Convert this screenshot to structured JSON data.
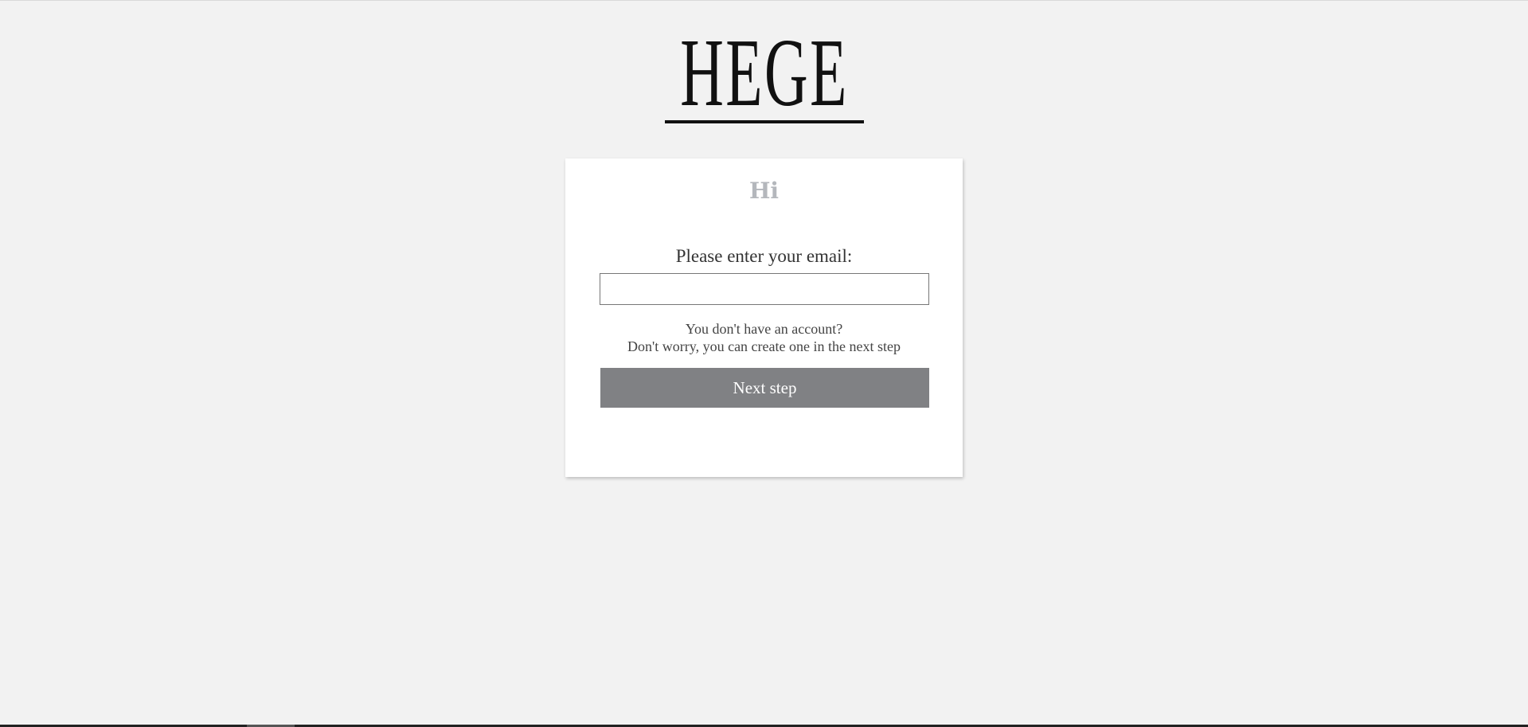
{
  "logo": {
    "text": "HEGE"
  },
  "card": {
    "greeting": "Hi",
    "email_label": "Please enter your email:",
    "email_value": "",
    "email_placeholder": "",
    "info_line1": "You don't have an account?",
    "info_line2": "Don't worry, you can create one in the next step",
    "next_button_label": "Next step"
  },
  "colors": {
    "page_background": "#f2f2f2",
    "card_background": "#ffffff",
    "greeting_text": "#b4b7bc",
    "button_background": "#808184",
    "button_text": "#ffffff",
    "logo": "#111111"
  }
}
